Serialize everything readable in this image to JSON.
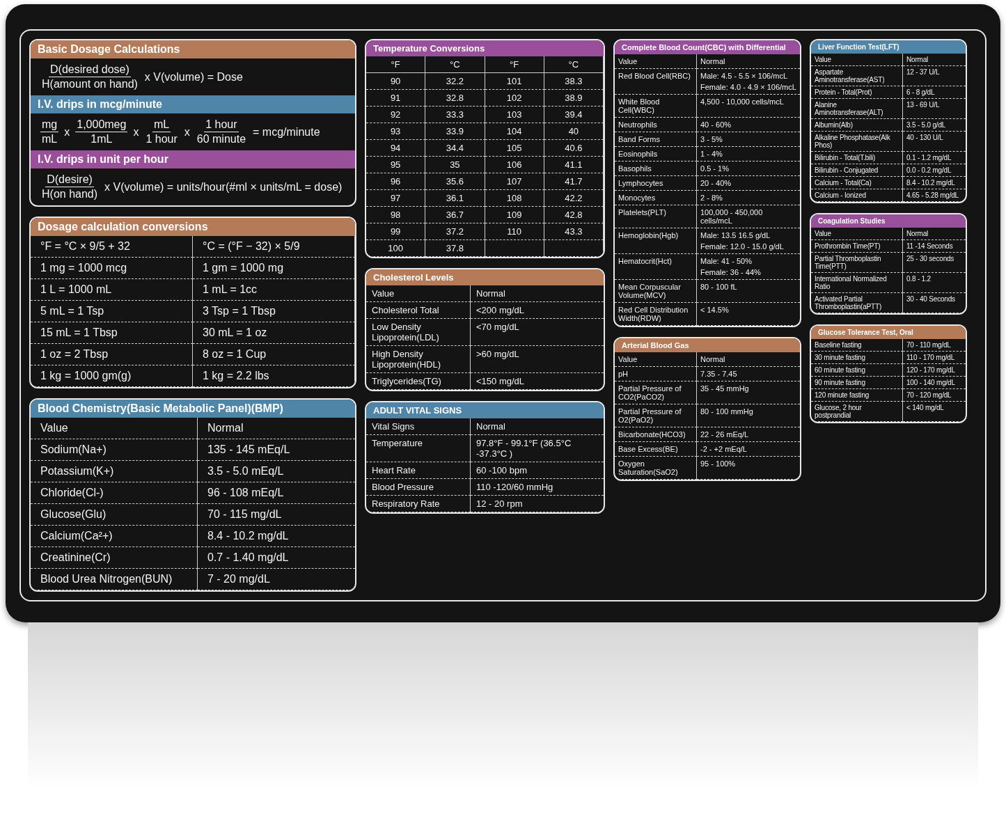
{
  "columns": [
    {
      "panels": [
        {
          "kind": "formulas",
          "sections": [
            {
              "title": "Basic Dosage Calculations",
              "color": "#b57a58",
              "terms": [
                {
                  "kind": "fraction",
                  "top": "D(desired dose)",
                  "bottom": "H(amount on hand)"
                },
                {
                  "kind": "text",
                  "text": "x V(volume) = Dose"
                }
              ]
            },
            {
              "title": "I.V. drips in mcg/minute",
              "color": "#4f86a8",
              "terms": [
                {
                  "kind": "fraction",
                  "top": "mg",
                  "bottom": "mL"
                },
                {
                  "kind": "text",
                  "text": "x"
                },
                {
                  "kind": "fraction",
                  "top": "1,000meg",
                  "bottom": "1mL"
                },
                {
                  "kind": "text",
                  "text": "x"
                },
                {
                  "kind": "fraction",
                  "top": "mL",
                  "bottom": "1 hour"
                },
                {
                  "kind": "text",
                  "text": "x"
                },
                {
                  "kind": "fraction",
                  "top": "1 hour",
                  "bottom": "60 minute"
                },
                {
                  "kind": "text",
                  "text": "= mcg/minute"
                }
              ]
            },
            {
              "title": "I.V. drips in unit per hour",
              "color": "#9a4f9a",
              "terms": [
                {
                  "kind": "fraction",
                  "top": "D(desire)",
                  "bottom": "H(on hand)"
                },
                {
                  "kind": "text",
                  "text": "x V(volume) = units/hour(#ml × units/mL = dose)"
                }
              ]
            }
          ]
        },
        {
          "kind": "grid",
          "title": "Dosage calculation conversions",
          "color": "#b57a58",
          "rows": [
            [
              "°F = °C × 9/5 + 32",
              "°C = (°F − 32) × 5/9"
            ],
            [
              "1 mg = 1000 mcg",
              "1 gm = 1000 mg"
            ],
            [
              "1 L = 1000 mL",
              "1 mL = 1cc"
            ],
            [
              "5 mL = 1 Tsp",
              "3 Tsp = 1 Tbsp"
            ],
            [
              "15 mL = 1 Tbsp",
              "30 mL = 1 oz"
            ],
            [
              "1 oz = 2 Tbsp",
              "8 oz = 1 Cup"
            ],
            [
              "1 kg = 1000 gm(g)",
              "1 kg = 2.2 lbs"
            ]
          ]
        },
        {
          "kind": "table",
          "title": "Blood Chemistry(Basic Metabolic Panel)(BMP)",
          "color": "#4f86a8",
          "header": [
            "Value",
            "Normal"
          ],
          "rows": [
            {
              "label": "Sodium(Na+)",
              "values": [
                "135 - 145 mEq/L"
              ]
            },
            {
              "label": "Potassium(K+)",
              "values": [
                "3.5 - 5.0 mEq/L"
              ]
            },
            {
              "label": "Chloride(Cl-)",
              "values": [
                "96 - 108 mEq/L"
              ]
            },
            {
              "label": "Glucose(Glu)",
              "values": [
                "70 - 115 mg/dL"
              ]
            },
            {
              "label": "Calcium(Ca²+)",
              "values": [
                "8.4 - 10.2 mg/dL"
              ]
            },
            {
              "label": "Creatinine(Cr)",
              "values": [
                "0.7 - 1.40 mg/dL"
              ]
            },
            {
              "label": "Blood Urea Nitrogen(BUN)",
              "values": [
                "7 - 20 mg/dL"
              ]
            }
          ]
        }
      ]
    },
    {
      "panels": [
        {
          "kind": "grid",
          "title": "Temperature Conversions",
          "color": "#9a4f9a",
          "headers": [
            "°F",
            "°C",
            "°F",
            "°C"
          ],
          "rows": [
            [
              "90",
              "32.2",
              "101",
              "38.3"
            ],
            [
              "91",
              "32.8",
              "102",
              "38.9"
            ],
            [
              "92",
              "33.3",
              "103",
              "39.4"
            ],
            [
              "93",
              "33.9",
              "104",
              "40"
            ],
            [
              "94",
              "34.4",
              "105",
              "40.6"
            ],
            [
              "95",
              "35",
              "106",
              "41.1"
            ],
            [
              "96",
              "35.6",
              "107",
              "41.7"
            ],
            [
              "97",
              "36.1",
              "108",
              "42.2"
            ],
            [
              "98",
              "36.7",
              "109",
              "42.8"
            ],
            [
              "99",
              "37.2",
              "110",
              "43.3"
            ],
            [
              "100",
              "37.8"
            ]
          ]
        },
        {
          "kind": "table",
          "title": "Cholesterol Levels",
          "color": "#b57a58",
          "header": [
            "Value",
            "Normal"
          ],
          "rows": [
            {
              "label": "Cholesterol Total",
              "values": [
                "<200 mg/dL"
              ]
            },
            {
              "label": "Low Density Lipoprotein(LDL)",
              "values": [
                "<70 mg/dL"
              ]
            },
            {
              "label": "High Density Lipoprotein(HDL)",
              "values": [
                ">60 mg/dL"
              ]
            },
            {
              "label": "Triglycerides(TG)",
              "values": [
                "<150 mg/dL"
              ]
            }
          ]
        },
        {
          "kind": "table",
          "title": "ADULT VITAL SIGNS",
          "color": "#4f86a8",
          "header": [
            "Vital Signs",
            "Normal"
          ],
          "rows": [
            {
              "label": "Temperature",
              "values": [
                "97.8°F - 99.1°F (36.5°C -37.3°C )"
              ]
            },
            {
              "label": "Heart Rate",
              "values": [
                "60 -100 bpm"
              ]
            },
            {
              "label": "Blood Pressure",
              "values": [
                "110 -120/60 mmHg"
              ]
            },
            {
              "label": "Respiratory Rate",
              "values": [
                "12 - 20 rpm"
              ]
            }
          ]
        }
      ]
    },
    {
      "panels": [
        {
          "kind": "table",
          "title": "Complete Blood Count(CBC) with Differential",
          "color": "#9a4f9a",
          "header": [
            "Value",
            "Normal"
          ],
          "rows": [
            {
              "label": "Red Blood Cell(RBC)",
              "values": [
                "Male: 4.5 - 5.5 × 106/mcL",
                "Female: 4.0 - 4.9 × 106/mcL"
              ]
            },
            {
              "label": "White Blood Cell(WBC)",
              "values": [
                "4,500 - 10,000 cells/mcL"
              ]
            },
            {
              "label": "Neutrophils",
              "values": [
                "40 - 60%"
              ]
            },
            {
              "label": "Band Forms",
              "values": [
                "3 - 5%"
              ]
            },
            {
              "label": "Eosinophils",
              "values": [
                "1 - 4%"
              ]
            },
            {
              "label": "Basophils",
              "values": [
                "0.5 - 1%"
              ]
            },
            {
              "label": "Lymphocytes",
              "values": [
                "20 - 40%"
              ]
            },
            {
              "label": "Monocytes",
              "values": [
                "2 - 8%"
              ]
            },
            {
              "label": "Platelets(PLT)",
              "values": [
                "100,000 - 450,000 cells/mcL"
              ]
            },
            {
              "label": "Hemoglobin(Hgb)",
              "values": [
                "Male: 13.5 16.5 g/dL",
                "Female: 12.0 - 15.0 g/dL"
              ]
            },
            {
              "label": "Hematocrit(Hct)",
              "values": [
                "Male: 41 - 50%",
                "Female: 36 - 44%"
              ]
            },
            {
              "label": "Mean Corpuscular Volume(MCV)",
              "values": [
                "80 - 100 fL"
              ]
            },
            {
              "label": "Red Cell Distribution Width(RDW)",
              "values": [
                "< 14.5%"
              ]
            }
          ]
        },
        {
          "kind": "table",
          "title": "Arterial Blood Gas",
          "color": "#b57a58",
          "header": [
            "Value",
            "Normal"
          ],
          "rows": [
            {
              "label": "pH",
              "values": [
                "7.35 - 7.45"
              ]
            },
            {
              "label": "Partial Pressure of CO2(PaCO2)",
              "values": [
                "35 - 45 mmHg"
              ]
            },
            {
              "label": "Partial Pressure of O2(PaO2)",
              "values": [
                "80 - 100 mmHg"
              ]
            },
            {
              "label": "Bicarbonate(HCO3)",
              "values": [
                "22 - 26 mEq/L"
              ]
            },
            {
              "label": "Base Excess(BE)",
              "values": [
                "-2 - +2 mEq/L"
              ]
            },
            {
              "label": "Oxygen Saturation(SaO2)",
              "values": [
                "95 - 100%"
              ]
            }
          ]
        }
      ]
    },
    {
      "panels": [
        {
          "kind": "table",
          "title": "Liver Function Test(LFT)",
          "color": "#4f86a8",
          "header": [
            "Value",
            "Normal"
          ],
          "rows": [
            {
              "label": "Aspartate Aminotransferase(AST)",
              "values": [
                "12 - 37 U/L"
              ]
            },
            {
              "label": "Protein - Total(Prot)",
              "values": [
                "6 - 8 g/dL"
              ]
            },
            {
              "label": "Alanine Aminotransferase(ALT)",
              "values": [
                "13 - 69 U/L"
              ]
            },
            {
              "label": "Albumin(Alb)",
              "values": [
                "3.5 - 5.0 g/dL"
              ]
            },
            {
              "label": "Alkaline Phosphatase(Alk Phos)",
              "values": [
                "40 - 130 U/L"
              ]
            },
            {
              "label": "Bilirubin - Total(T.bili)",
              "values": [
                "0.1 - 1.2 mg/dL"
              ]
            },
            {
              "label": "Bilirubin - Conjugated",
              "values": [
                "0.0 - 0.2 mg/dL"
              ]
            },
            {
              "label": "Calcium - Total(Ca)",
              "values": [
                "8.4 - 10.2 mg/dL"
              ]
            },
            {
              "label": "Calcium - Ionized",
              "values": [
                "4.65 - 5.28 mg/dL"
              ]
            }
          ]
        },
        {
          "kind": "table",
          "title": "Coagulation Studies",
          "color": "#9a4f9a",
          "header": [
            "Value",
            "Normal"
          ],
          "rows": [
            {
              "label": "Prothrombin Time(PT)",
              "values": [
                "11 -14 Seconds"
              ]
            },
            {
              "label": "Partial Thromboplastin Time(PTT)",
              "values": [
                "25 - 30 seconds"
              ]
            },
            {
              "label": "International Normalized Ratio",
              "values": [
                "0.8 - 1.2"
              ]
            },
            {
              "label": "Activated Partial Thromboplastin(aPTT)",
              "values": [
                "30 - 40 Seconds"
              ]
            }
          ]
        },
        {
          "kind": "table",
          "title": "Glucose Tolerance Test, Oral",
          "color": "#b57a58",
          "rows": [
            {
              "label": "Baseline fasting",
              "values": [
                "70 - 110 mg/dL"
              ]
            },
            {
              "label": "30 minute fasting",
              "values": [
                "110 - 170 mg/dL"
              ]
            },
            {
              "label": "60 minute fasting",
              "values": [
                "120 - 170 mg/dL"
              ]
            },
            {
              "label": "90 minute fasting",
              "values": [
                "100 - 140 mg/dL"
              ]
            },
            {
              "label": "120 minute fasting",
              "values": [
                "70 - 120 mg/dL"
              ]
            },
            {
              "label": "Glucose, 2 hour postprandial",
              "values": [
                "< 140 mg/dL"
              ]
            }
          ]
        }
      ]
    }
  ]
}
